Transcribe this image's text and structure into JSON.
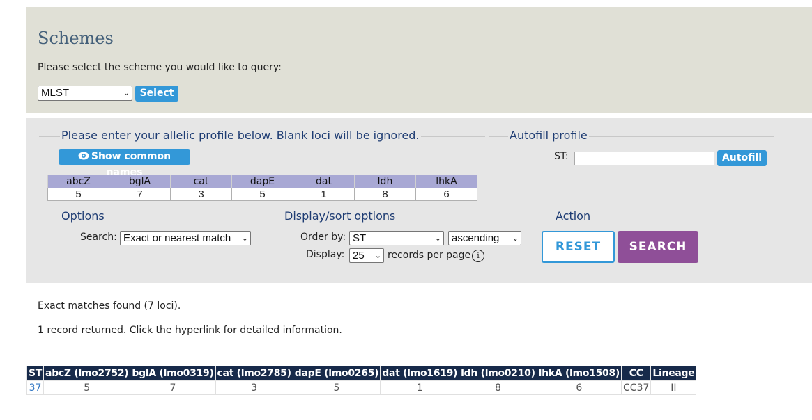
{
  "schemes": {
    "title": "Schemes",
    "prompt": "Please select the scheme you would like to query:",
    "selected_scheme": "MLST",
    "select_button": "Select"
  },
  "allelic": {
    "legend": "Please enter your allelic profile below. Blank loci will be ignored.",
    "show_common_names": "Show common names",
    "loci": [
      {
        "name": "abcZ",
        "value": "5"
      },
      {
        "name": "bglA",
        "value": "7"
      },
      {
        "name": "cat",
        "value": "3"
      },
      {
        "name": "dapE",
        "value": "5"
      },
      {
        "name": "dat",
        "value": "1"
      },
      {
        "name": "ldh",
        "value": "8"
      },
      {
        "name": "lhkA",
        "value": "6"
      }
    ]
  },
  "autofill": {
    "legend": "Autofill profile",
    "st_label": "ST:",
    "st_value": "",
    "button": "Autofill"
  },
  "options": {
    "legend": "Options",
    "search_label": "Search:",
    "search_value": "Exact or nearest match"
  },
  "display": {
    "legend": "Display/sort options",
    "order_label": "Order by:",
    "order_value": "ST",
    "direction_value": "ascending",
    "display_label": "Display:",
    "display_value": "25",
    "records_suffix": "records per page",
    "info_glyph": "i"
  },
  "action": {
    "legend": "Action",
    "reset": "RESET",
    "search": "SEARCH"
  },
  "messages": {
    "matches": "Exact matches found (7 loci).",
    "returned": "1 record returned. Click the hyperlink for detailed information."
  },
  "results": {
    "headers": [
      "ST",
      "abcZ (lmo2752)",
      "bglA (lmo0319)",
      "cat (lmo2785)",
      "dapE (lmo0265)",
      "dat (lmo1619)",
      "ldh (lmo0210)",
      "lhkA (lmo1508)",
      "CC",
      "Lineage"
    ],
    "rows": [
      [
        "37",
        "5",
        "7",
        "3",
        "5",
        "1",
        "8",
        "6",
        "CC37",
        "II"
      ]
    ]
  },
  "colors": {
    "accent_blue": "#3398d8",
    "search_purple": "#8f4f98",
    "header_navy": "#172a4a"
  }
}
